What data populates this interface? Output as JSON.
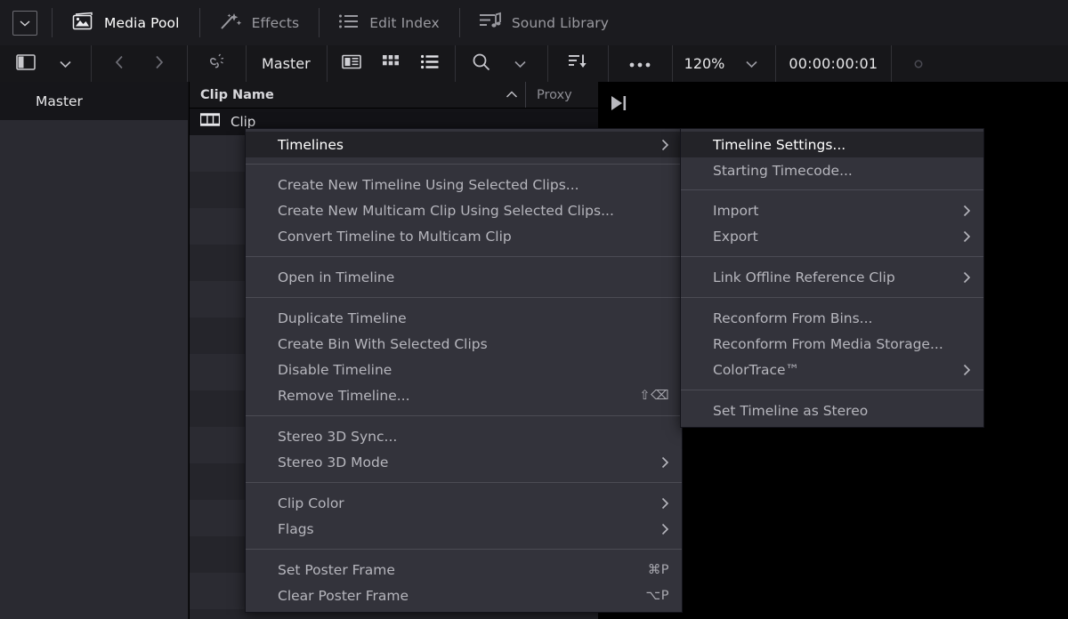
{
  "header": {
    "dropdown_icon": "chevron-down-icon",
    "items": [
      {
        "label": "Media Pool",
        "icon": "media-pool-icon",
        "active": true
      },
      {
        "label": "Effects",
        "icon": "effects-wand-icon",
        "active": false
      },
      {
        "label": "Edit Index",
        "icon": "edit-index-list-icon",
        "active": false
      },
      {
        "label": "Sound Library",
        "icon": "sound-library-icon",
        "active": false
      }
    ]
  },
  "toolbar": {
    "sidebar_toggle_icon": "sidebar-panel-icon",
    "sidebar_chevron_icon": "chevron-down-icon",
    "back_icon": "chevron-left-icon",
    "forward_icon": "chevron-right-icon",
    "unlink_icon": "broken-link-icon",
    "bin_name": "Master",
    "metadata_view_icon": "metadata-view-icon",
    "thumbnail_view_icon": "thumbnail-grid-icon",
    "list_view_icon": "list-view-icon",
    "search_icon": "search-icon",
    "search_chevron_icon": "chevron-down-icon",
    "sort_icon": "sort-descending-icon",
    "options_icon": "ellipsis-icon",
    "zoom_level": "120%",
    "zoom_chevron_icon": "chevron-down-icon",
    "timecode": "00:00:00:01",
    "record_dot_icon": "circle-icon"
  },
  "sidebar": {
    "items": [
      {
        "label": "Master",
        "selected": true
      }
    ]
  },
  "pool": {
    "columns": [
      {
        "label": "Clip Name",
        "sort_icon": "sort-ascending-caret-icon"
      },
      {
        "label": "Proxy"
      }
    ],
    "rows": [
      {
        "name": "Clip",
        "icon": "timeline-filmstrip-icon",
        "selected": true
      }
    ]
  },
  "preview": {
    "goto_end_icon": "go-to-end-icon"
  },
  "context_menu": {
    "groups": [
      {
        "items": [
          {
            "label": "Timelines",
            "submenu": true,
            "highlighted": true
          }
        ]
      },
      {
        "items": [
          {
            "label": "Create New Timeline Using Selected Clips...",
            "submenu": false
          },
          {
            "label": "Create New Multicam Clip Using Selected Clips...",
            "submenu": false
          },
          {
            "label": "Convert Timeline to Multicam Clip",
            "submenu": false
          }
        ]
      },
      {
        "items": [
          {
            "label": "Open in Timeline",
            "submenu": false
          }
        ]
      },
      {
        "items": [
          {
            "label": "Duplicate Timeline",
            "submenu": false
          },
          {
            "label": "Create Bin With Selected Clips",
            "submenu": false
          },
          {
            "label": "Disable Timeline",
            "submenu": false
          },
          {
            "label": "Remove Timeline...",
            "submenu": false,
            "shortcut": "⇧⌫"
          }
        ]
      },
      {
        "items": [
          {
            "label": "Stereo 3D Sync...",
            "submenu": false
          },
          {
            "label": "Stereo 3D Mode",
            "submenu": true
          }
        ]
      },
      {
        "items": [
          {
            "label": "Clip Color",
            "submenu": true
          },
          {
            "label": "Flags",
            "submenu": true
          }
        ]
      },
      {
        "items": [
          {
            "label": "Set Poster Frame",
            "submenu": false,
            "shortcut": "⌘P"
          },
          {
            "label": "Clear Poster Frame",
            "submenu": false,
            "shortcut": "⌥P"
          }
        ]
      }
    ]
  },
  "submenu": {
    "groups": [
      {
        "items": [
          {
            "label": "Timeline Settings...",
            "submenu": false,
            "highlighted": true
          },
          {
            "label": "Starting Timecode...",
            "submenu": false
          }
        ]
      },
      {
        "items": [
          {
            "label": "Import",
            "submenu": true
          },
          {
            "label": "Export",
            "submenu": true
          }
        ]
      },
      {
        "items": [
          {
            "label": "Link Offline Reference Clip",
            "submenu": true
          }
        ]
      },
      {
        "items": [
          {
            "label": "Reconform From Bins...",
            "submenu": false
          },
          {
            "label": "Reconform From Media Storage...",
            "submenu": false
          },
          {
            "label": "ColorTrace™",
            "submenu": true
          }
        ]
      },
      {
        "items": [
          {
            "label": "Set Timeline as Stereo",
            "submenu": false
          }
        ]
      }
    ]
  },
  "colors": {
    "menu_bg": "#33333b",
    "menu_highlight": "#232328",
    "header_bg": "#1b1b1f",
    "toolbar_bg": "#17171a",
    "sidebar_bg": "#2a2a31",
    "text_primary": "#ffffff",
    "text_secondary": "#b6b6bd"
  }
}
